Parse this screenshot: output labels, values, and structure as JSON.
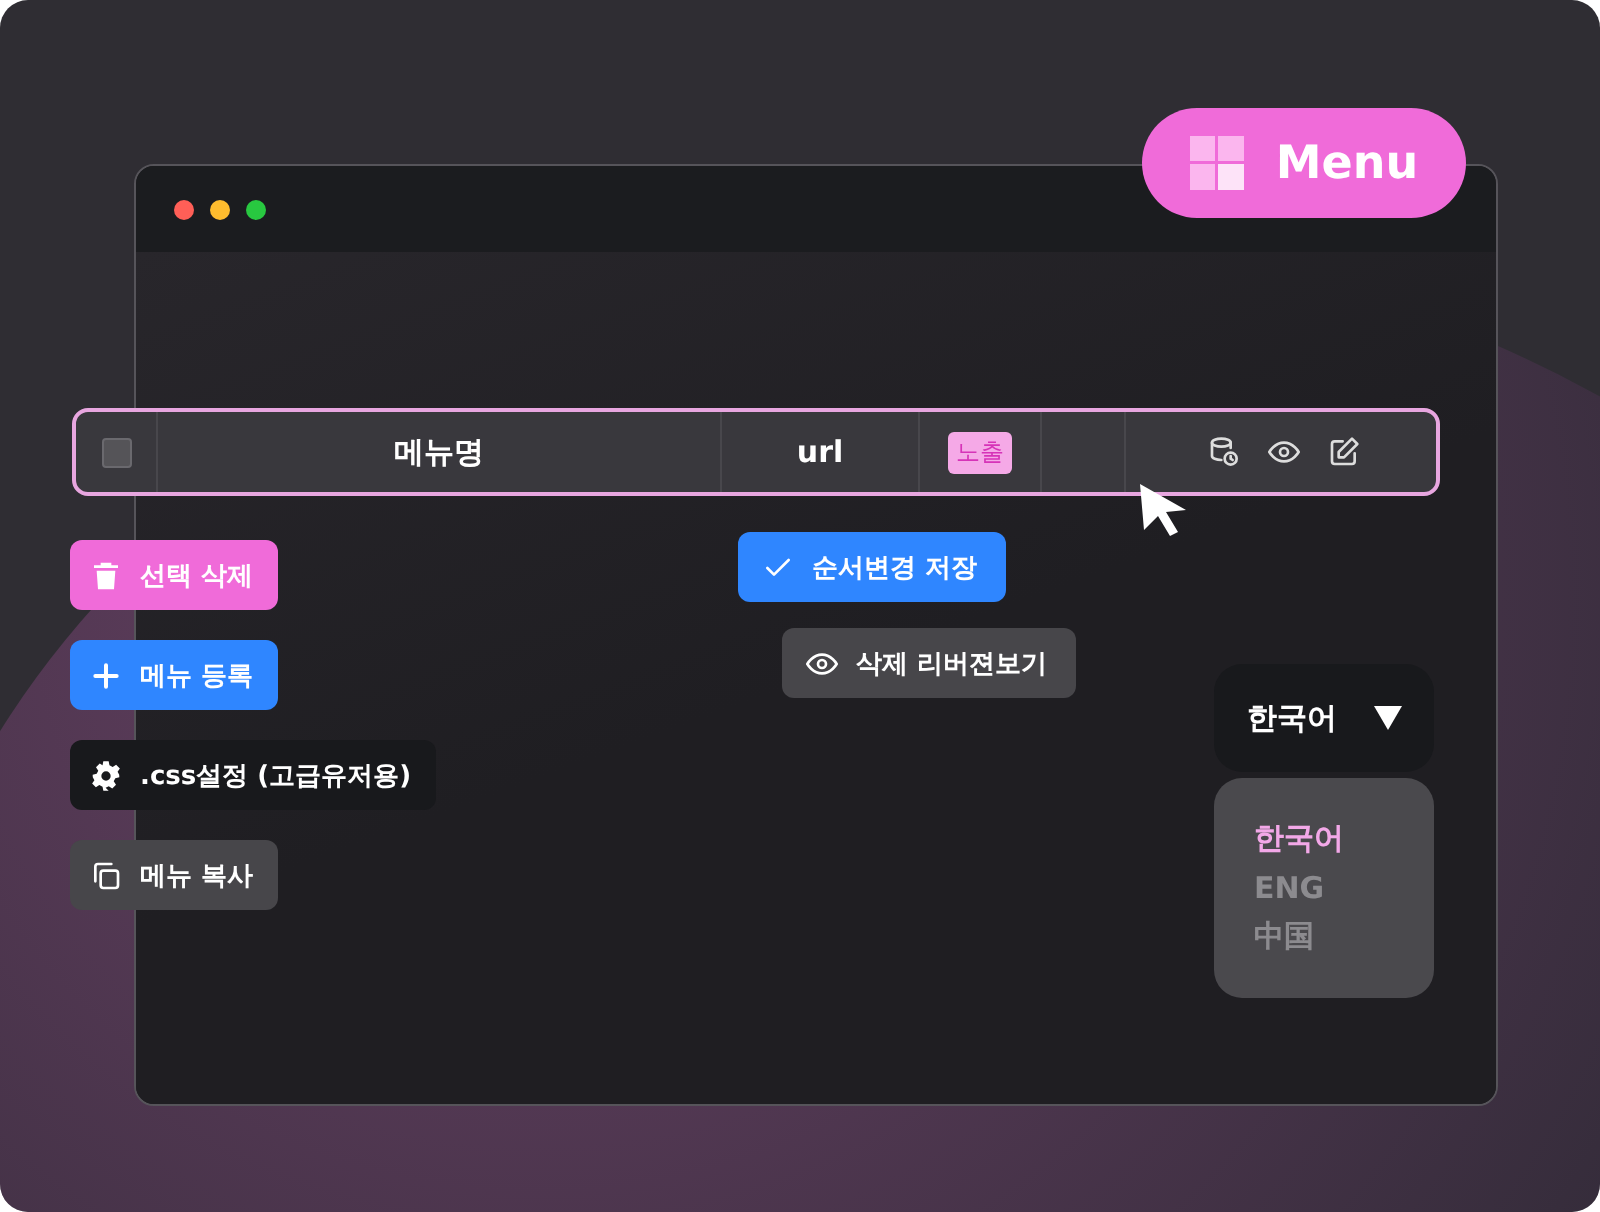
{
  "menu_button": {
    "label": "Menu"
  },
  "table_row": {
    "checked": false,
    "columns": [
      "메뉴명",
      "url"
    ],
    "badge": "노출",
    "actions": [
      {
        "kind": "history"
      },
      {
        "kind": "view"
      },
      {
        "kind": "edit"
      }
    ]
  },
  "left_buttons": [
    {
      "label": "선택 삭제",
      "kind": "delete"
    },
    {
      "label": "메뉴 등록",
      "kind": "add"
    },
    {
      "label": ".css설정 (고급유저용)",
      "kind": "settings"
    },
    {
      "label": "메뉴 복사",
      "kind": "copy"
    }
  ],
  "order_buttons": [
    {
      "label": "순서변경 저장",
      "kind": "save"
    },
    {
      "label": "삭제 리버젼보기",
      "kind": "preview"
    }
  ],
  "language_select": {
    "value": "한국어",
    "expanded": true,
    "options": [
      {
        "label": "한국어",
        "selected": true
      },
      {
        "label": "ENG",
        "selected": false
      },
      {
        "label": "中国",
        "selected": false
      }
    ]
  }
}
